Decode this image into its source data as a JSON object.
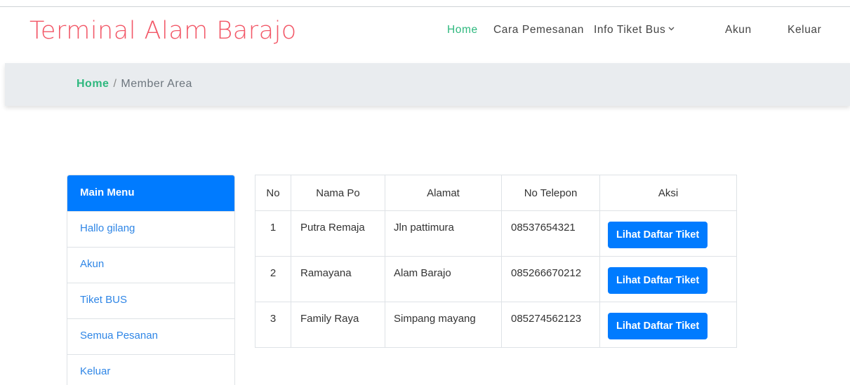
{
  "brand": "Terminal Alam Barajo",
  "nav": {
    "home": "Home",
    "cara": "Cara Pemesanan",
    "info": "Info Tiket Bus",
    "akun": "Akun",
    "keluar": "Keluar"
  },
  "breadcrumb": {
    "home": "Home",
    "separator": "/",
    "current": "Member Area"
  },
  "sidebar": {
    "header": "Main Menu",
    "items": [
      {
        "label": "Hallo gilang"
      },
      {
        "label": "Akun"
      },
      {
        "label": "Tiket BUS"
      },
      {
        "label": "Semua Pesanan"
      },
      {
        "label": "Keluar"
      }
    ]
  },
  "table": {
    "columns": [
      "No",
      "Nama Po",
      "Alamat",
      "No Telepon",
      "Aksi"
    ],
    "rows": [
      {
        "no": "1",
        "nama": "Putra Remaja",
        "alamat": "Jln pattimura",
        "telepon": "08537654321",
        "aksi": "Lihat Daftar Tiket"
      },
      {
        "no": "2",
        "nama": "Ramayana",
        "alamat": "Alam Barajo",
        "telepon": "085266670212",
        "aksi": "Lihat Daftar Tiket"
      },
      {
        "no": "3",
        "nama": "Family Raya",
        "alamat": "Simpang mayang",
        "telepon": "085274562123",
        "aksi": "Lihat Daftar Tiket"
      }
    ]
  },
  "colors": {
    "brand": "#f25767",
    "active_nav": "#2eb87e",
    "primary": "#007bff",
    "link": "#2f86e6"
  }
}
